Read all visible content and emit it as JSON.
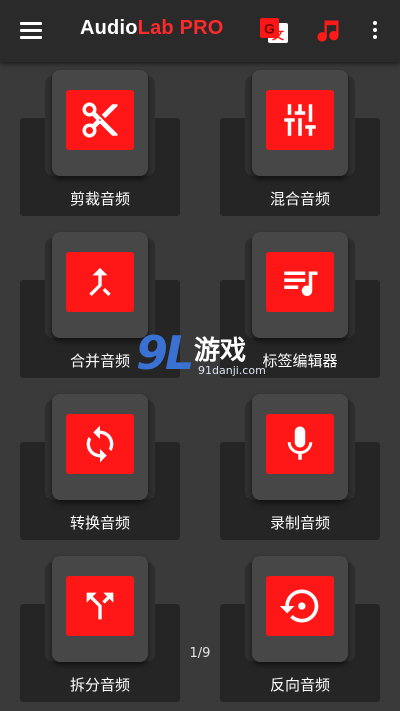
{
  "app": {
    "title_part1": "Audio",
    "title_part2": "Lab",
    "title_part3": " PRO",
    "colors": {
      "accent": "#ff1616",
      "toolbar": "#2a2a2a",
      "background": "#3a3a3a"
    }
  },
  "toolbar": {
    "icons": [
      "menu-icon",
      "translate-icon",
      "music-note-icon",
      "more-vert-icon"
    ]
  },
  "tiles": [
    {
      "label": "剪裁音频",
      "icon": "scissors-icon"
    },
    {
      "label": "混合音频",
      "icon": "mixer-icon"
    },
    {
      "label": "合并音频",
      "icon": "merge-icon"
    },
    {
      "label": "标签编辑器",
      "icon": "tag-list-icon"
    },
    {
      "label": "转换音频",
      "icon": "convert-icon"
    },
    {
      "label": "录制音频",
      "icon": "microphone-icon"
    },
    {
      "label": "拆分音频",
      "icon": "split-icon"
    },
    {
      "label": "反向音频",
      "icon": "reverse-icon"
    }
  ],
  "pager": {
    "text": "1/9"
  },
  "watermark": {
    "logo": "9L",
    "text": "游戏",
    "sub": "91danji.com"
  }
}
